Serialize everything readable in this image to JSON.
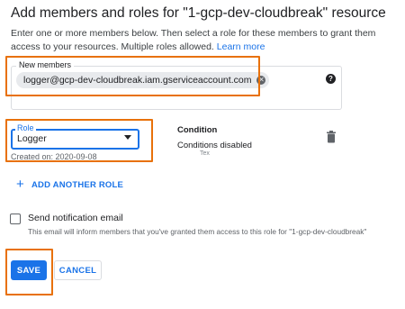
{
  "dialog": {
    "title": "Add members and roles for \"1-gcp-dev-cloudbreak\" resource",
    "description": "Enter one or more members below. Then select a role for these members to grant them access to your resources. Multiple roles allowed.",
    "learn_more": "Learn more"
  },
  "members": {
    "label": "New members",
    "chips": [
      "logger@gcp-dev-cloudbreak.iam.gserviceaccount.com"
    ],
    "help_icon": "question-icon"
  },
  "role": {
    "label": "Role",
    "value": "Logger",
    "created": "Created on: 2020-09-08"
  },
  "condition": {
    "title": "Condition",
    "status": "Conditions disabled",
    "sub": "Tex"
  },
  "add_role": {
    "label": "ADD ANOTHER ROLE"
  },
  "notification": {
    "label": "Send notification email",
    "help": "This email will inform members that you've granted them access to this role for \"1-gcp-dev-cloudbreak\"",
    "checked": false
  },
  "actions": {
    "save": "SAVE",
    "cancel": "CANCEL"
  },
  "colors": {
    "accent": "#1a73e8",
    "highlight": "#e8710a"
  }
}
